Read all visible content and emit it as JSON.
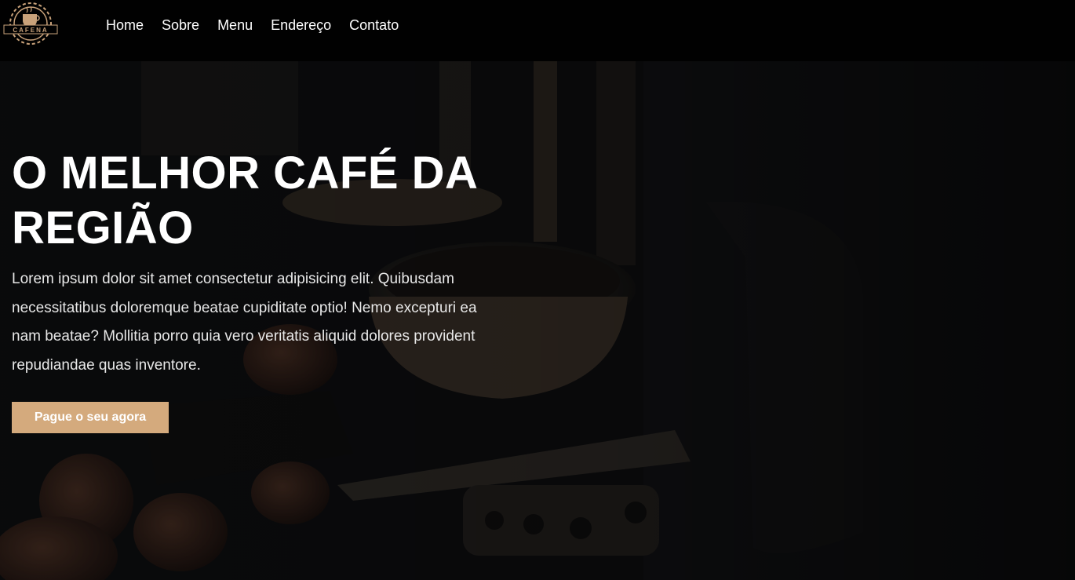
{
  "brand": {
    "logo_text": "CAFENA",
    "logo_icon": "coffee-cup-gear-logo"
  },
  "nav": {
    "items": [
      {
        "label": "Home"
      },
      {
        "label": "Sobre"
      },
      {
        "label": "Menu"
      },
      {
        "label": "Endereço"
      },
      {
        "label": "Contato"
      }
    ]
  },
  "hero": {
    "title": "O MELHOR CAFÉ DA REGIÃO",
    "text": "Lorem ipsum dolor sit amet consectetur adipisicing elit. Quibusdam necessitatibus doloremque beatae cupiditate optio! Nemo excepturi ea nam beatae? Mollitia porro quia vero veritatis aliquid dolores provident repudiandae quas inventore.",
    "button_label": "Pague o seu agora",
    "background_image": "espresso-machine-portafilter-photo"
  },
  "colors": {
    "navbar_bg": "#010101",
    "accent": "#d4aa7d",
    "hero_overlay": "#0d0e10",
    "text_primary": "#ffffff"
  }
}
